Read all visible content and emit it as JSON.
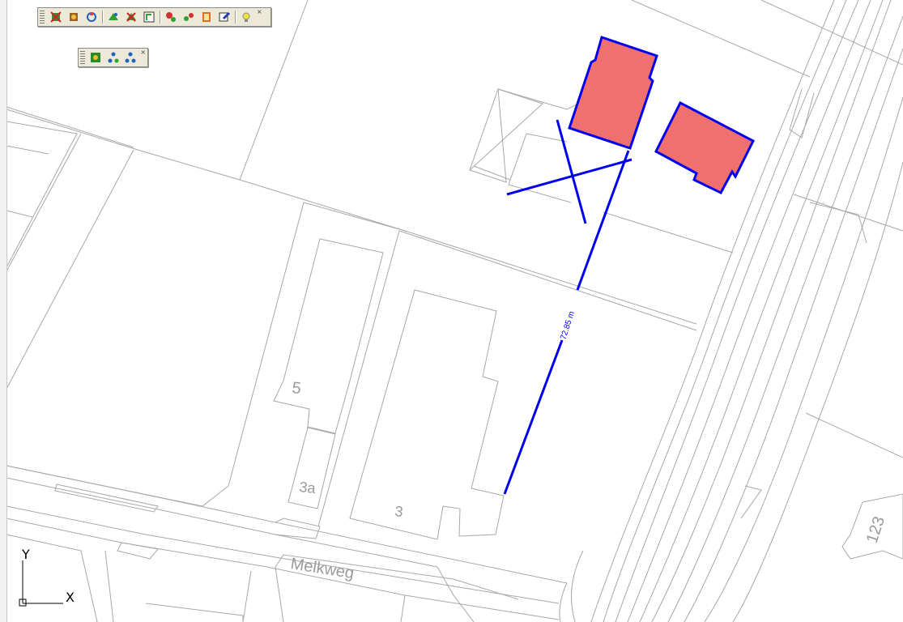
{
  "map": {
    "street_name": "Melkweg",
    "house_numbers": {
      "n5": "5",
      "n3a": "3a",
      "n3": "3",
      "n123": "123"
    },
    "dimension_label": "72.85 m",
    "colors": {
      "building_fill": "#f07070",
      "selection_stroke": "#0000ee",
      "parcel_lines": "#a8a8a8",
      "background": "#ffffff"
    }
  },
  "ucs": {
    "x_label": "X",
    "y_label": "Y"
  },
  "toolbar_main": {
    "buttons": [
      {
        "icon": "delete-object-icon"
      },
      {
        "icon": "settings-object-icon"
      },
      {
        "icon": "refresh-object-icon"
      },
      {
        "icon": "select-object-icon"
      },
      {
        "icon": "remove-object-icon"
      },
      {
        "icon": "zoom-object-icon"
      },
      {
        "icon": "query-object-icon"
      },
      {
        "icon": "link-object-icon"
      },
      {
        "icon": "report-icon"
      },
      {
        "icon": "edit-object-icon"
      },
      {
        "icon": "lamp-icon"
      }
    ],
    "close_glyph": "×"
  },
  "toolbar_secondary": {
    "buttons": [
      {
        "icon": "layers-icon"
      },
      {
        "icon": "network-icon"
      },
      {
        "icon": "tree-icon"
      }
    ],
    "close_glyph": "×"
  }
}
